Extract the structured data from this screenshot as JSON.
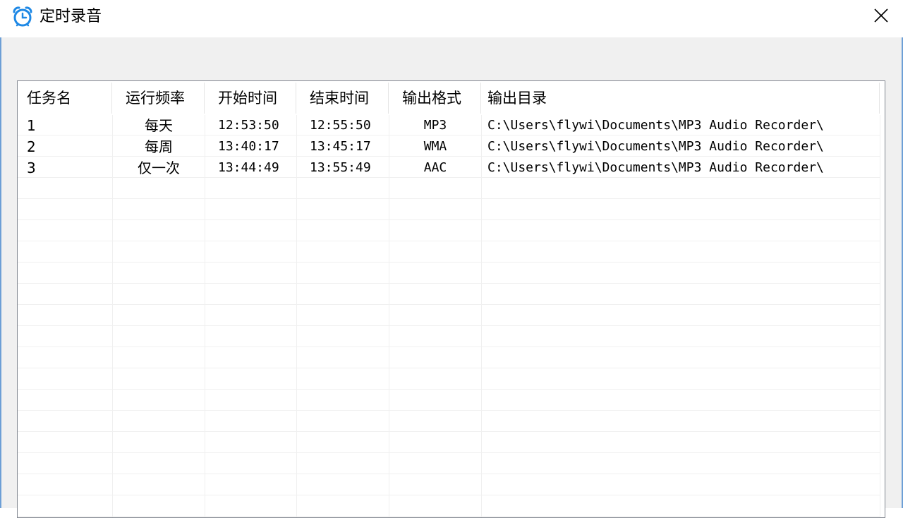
{
  "window": {
    "title": "定时录音",
    "icon": "alarm-clock-icon",
    "close_icon": "close-icon"
  },
  "colors": {
    "accent": "#1e88e5",
    "border": "#6d9fd6",
    "client_bg": "#f0f0f0"
  },
  "table": {
    "columns": [
      "任务名",
      "运行频率",
      "开始时间",
      "结束时间",
      "输出格式",
      "输出目录"
    ],
    "rows": [
      {
        "name": "1",
        "frequency": "每天",
        "start": "12:53:50",
        "end": "12:55:50",
        "format": "MP3",
        "dir": "C:\\Users\\flywi\\Documents\\MP3 Audio Recorder\\"
      },
      {
        "name": "2",
        "frequency": "每周",
        "start": "13:40:17",
        "end": "13:45:17",
        "format": "WMA",
        "dir": "C:\\Users\\flywi\\Documents\\MP3 Audio Recorder\\"
      },
      {
        "name": "3",
        "frequency": "仅一次",
        "start": "13:44:49",
        "end": "13:55:49",
        "format": "AAC",
        "dir": "C:\\Users\\flywi\\Documents\\MP3 Audio Recorder\\"
      }
    ]
  }
}
